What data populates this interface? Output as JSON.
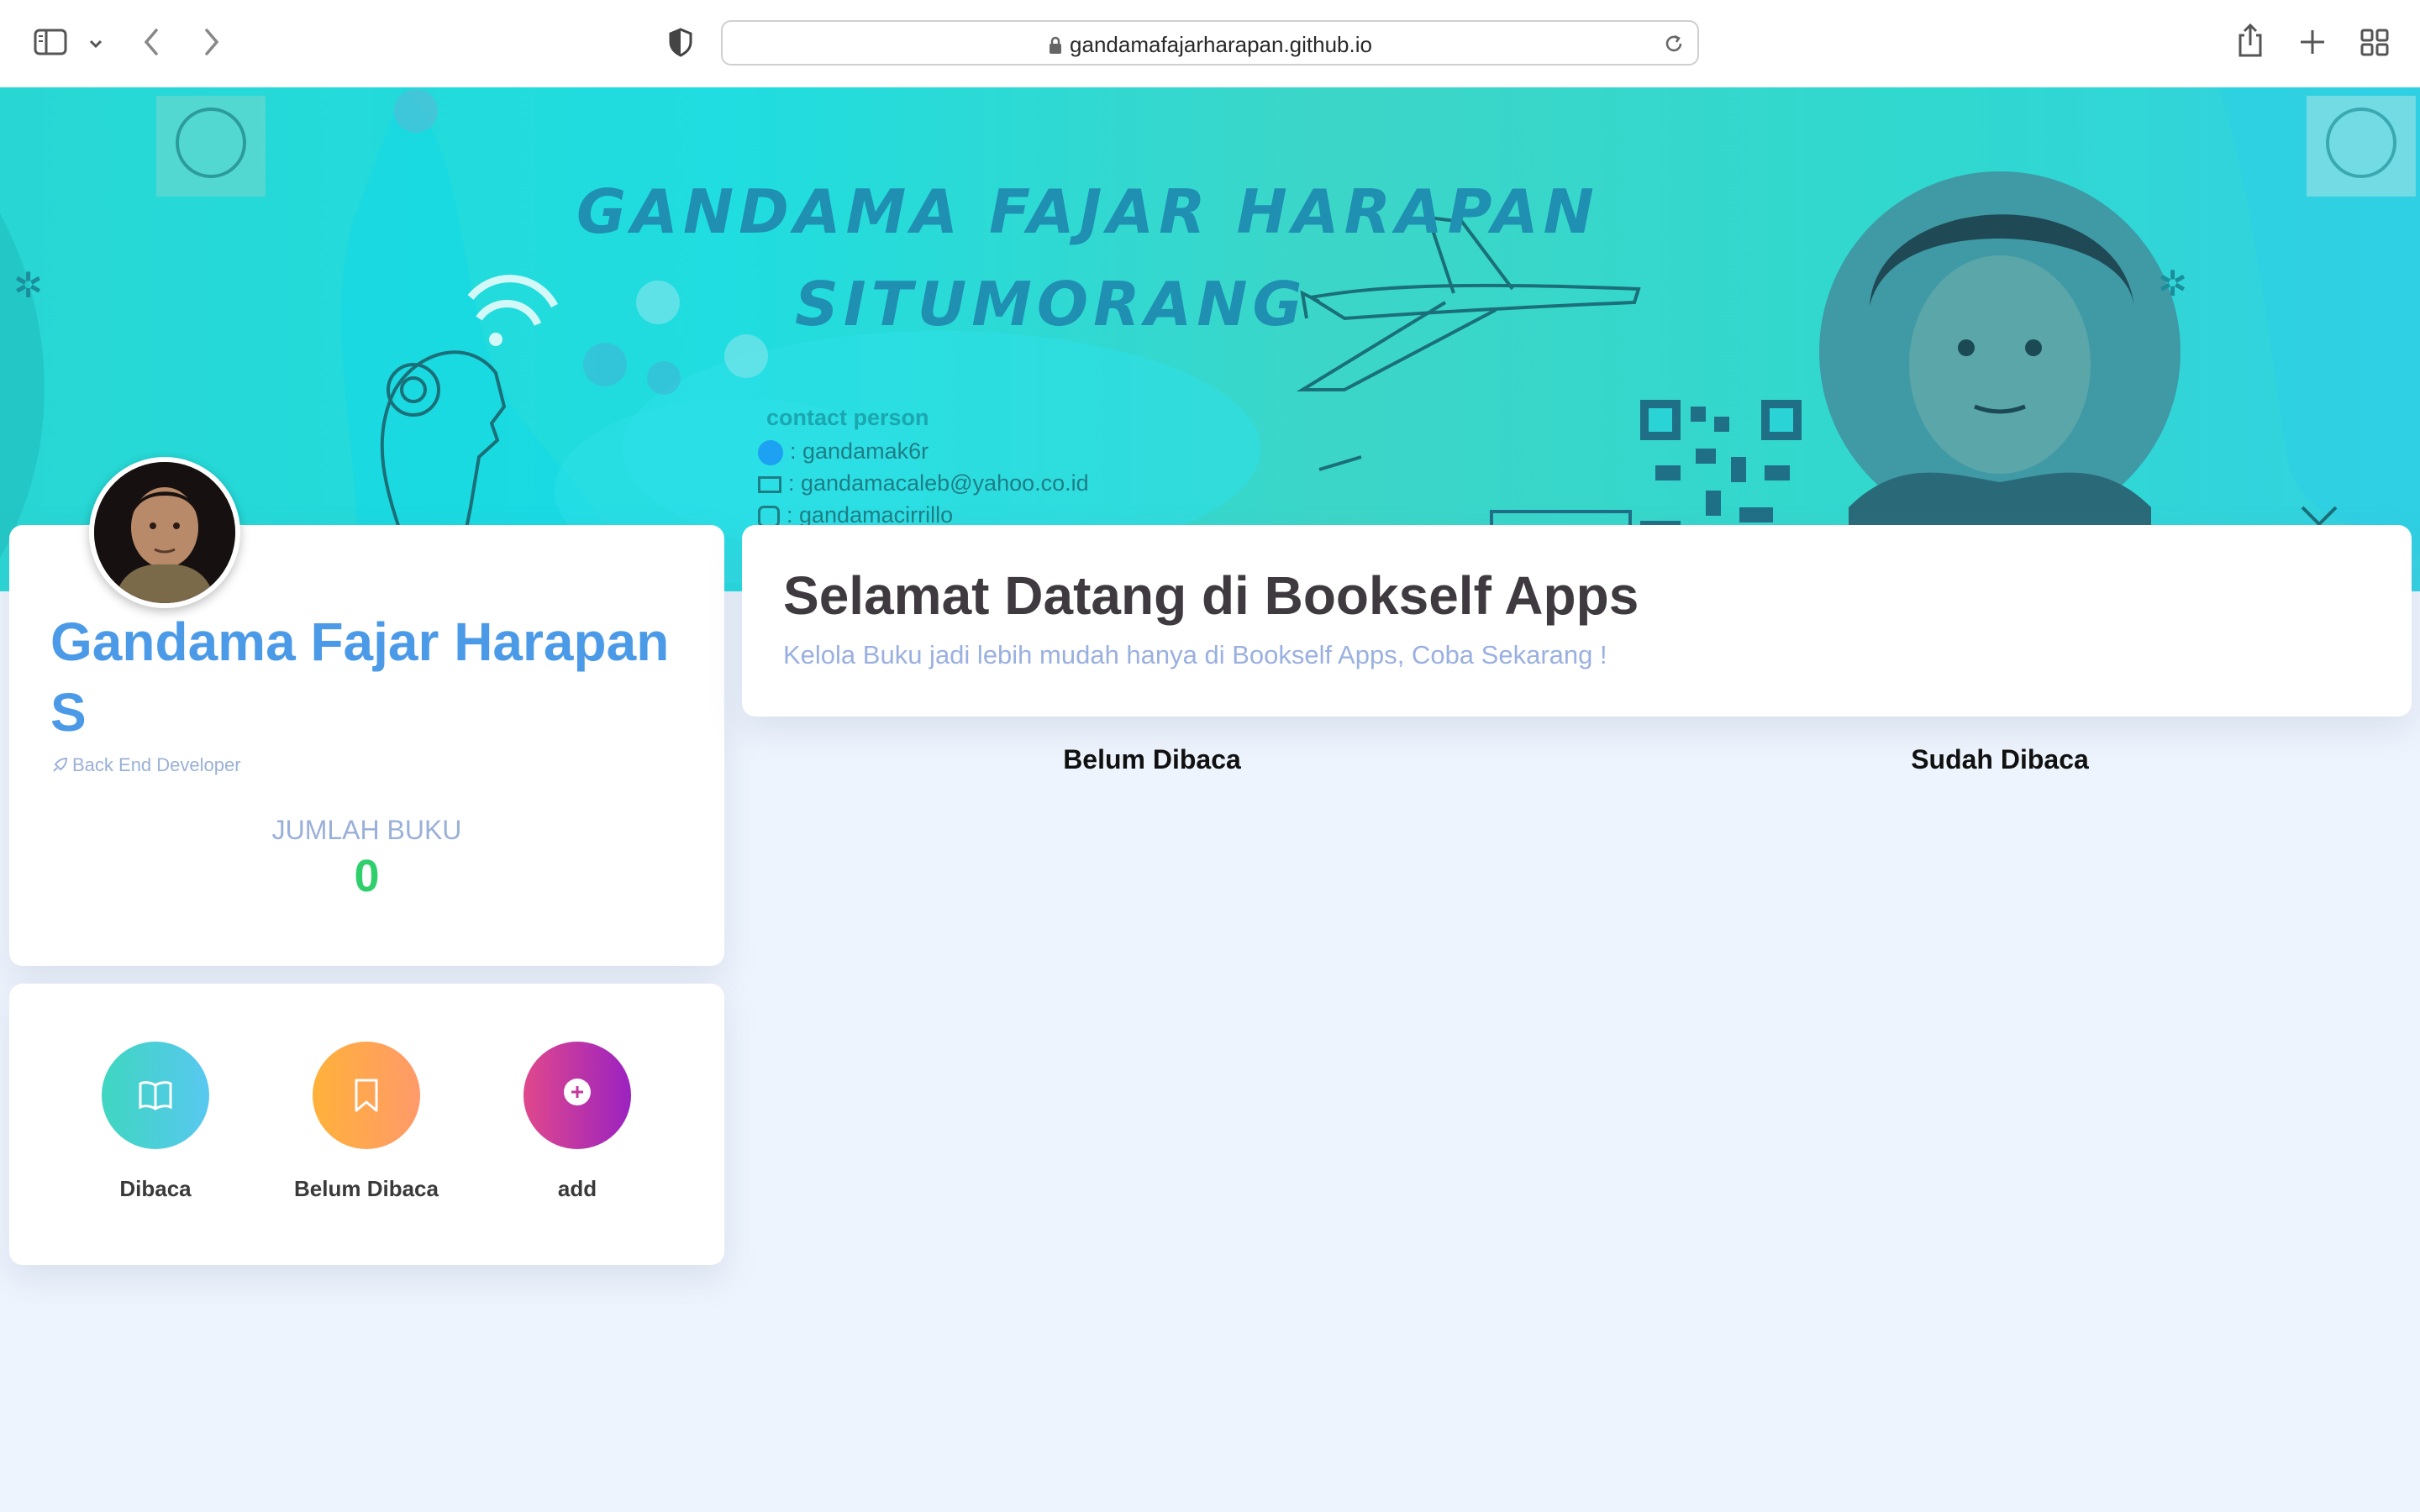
{
  "browser": {
    "url": "gandamafajarharapan.github.io"
  },
  "banner": {
    "title_line1": "GANDAMA FAJAR HARAPAN",
    "title_line2": "SITUMORANG",
    "contact_heading": "contact person",
    "contact_twitter": ": gandamak6r",
    "contact_email": ": gandamacaleb@yahoo.co.id",
    "contact_instagram": ": gandamacirrillo"
  },
  "profile": {
    "name": "Gandama Fajar Harapan S",
    "role": "Back End Developer",
    "count_label": "JUMLAH BUKU",
    "count_value": "0"
  },
  "menu": {
    "items": [
      {
        "label": "Dibaca",
        "icon": "book-open-icon",
        "color_from": "#3fd6c0",
        "color_to": "#58c8f0"
      },
      {
        "label": "Belum Dibaca",
        "icon": "bookmark-icon",
        "color_from": "#ffab3d",
        "color_to": "#ff9a6a"
      },
      {
        "label": "add",
        "icon": "plus-circle-icon",
        "color_from": "#e0488c",
        "color_to": "#9b22c0"
      }
    ]
  },
  "welcome": {
    "title": "Selamat Datang di Bookself Apps",
    "subtitle": "Kelola Buku jadi lebih mudah hanya di Bookself Apps, Coba Sekarang !"
  },
  "shelves": {
    "unread_heading": "Belum Dibaca",
    "read_heading": "Sudah Dibaca"
  },
  "colors": {
    "accent": "#4b9ae8",
    "count": "#2fcf6b",
    "background": "#eef4fd"
  }
}
